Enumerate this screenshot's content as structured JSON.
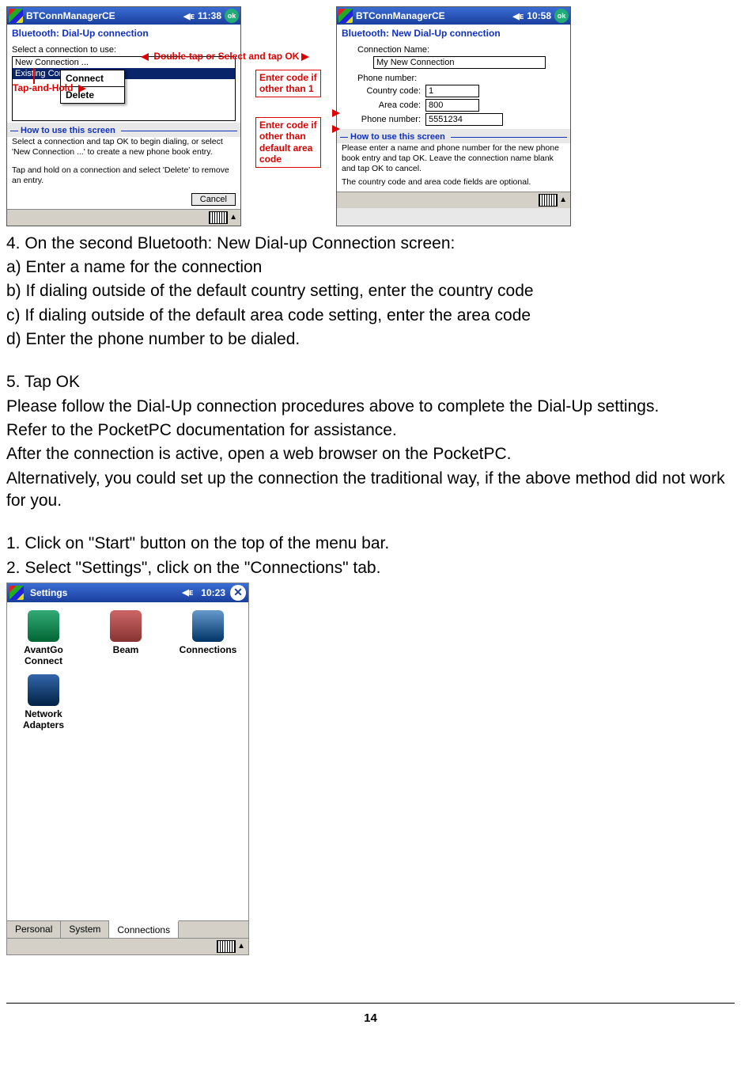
{
  "shot1": {
    "app_title": "BTConnManagerCE",
    "clock": "11:38",
    "ok": "ok",
    "subtitle": "Bluetooth: Dial-Up connection",
    "prompt": "Select a connection to use:",
    "list": {
      "item0": "New Connection ...",
      "item1_selected": "Existing Connection"
    },
    "ctx": {
      "connect": "Connect",
      "delete": "Delete"
    },
    "how_header": "How to use this screen",
    "help1": "Select a connection and tap OK to begin dialing, or select 'New Connection ...' to create a new phone book entry.",
    "help2": "Tap and hold on a connection and select 'Delete' to remove an entry.",
    "cancel": "Cancel"
  },
  "ann": {
    "doubletap": "Double-tap or Select and tap OK",
    "taphold": "Tap-and-Hold",
    "enter1a": "Enter code if",
    "enter1b": "other than 1",
    "enter2a": "Enter code if",
    "enter2b": "other than",
    "enter2c": "default area",
    "enter2d": "code"
  },
  "shot2": {
    "app_title": "BTConnManagerCE",
    "clock": "10:58",
    "ok": "ok",
    "subtitle": "Bluetooth: New Dial-Up connection",
    "name_label": "Connection Name:",
    "name_value": "My New Connection",
    "phone_label": "Phone number:",
    "cc_label": "Country code:",
    "cc_value": "1",
    "ac_label": "Area code:",
    "ac_value": "800",
    "pn_label": "Phone number:",
    "pn_value": "5551234",
    "how_header": "How to use this screen",
    "help1": "Please enter a name and phone number for the new phone book entry and tap OK. Leave the connection name blank and tap OK to cancel.",
    "help2": "The country code and area code fields are optional."
  },
  "body": {
    "l1": "4. On the second Bluetooth: New Dial-up Connection screen:",
    "l2": "a) Enter a name for the connection",
    "l3": "b) If dialing outside of the default country setting, enter the country code",
    "l4": "c) If dialing outside of the default area code setting, enter the area code",
    "l5": "d) Enter the phone number to be dialed.",
    "l6": "5. Tap OK",
    "l7": "Please follow the Dial-Up connection procedures above to complete the Dial-Up settings.",
    "l8": "Refer to the PocketPC documentation for assistance.",
    "l9": "After the connection is active, open a web browser on the PocketPC.",
    "l10": "Alternatively, you could set up the connection the traditional way, if the above method did not work for you.",
    "l11": "1. Click on \"Start\" button on the top of the menu bar.",
    "l12": "2. Select \"Settings\", click on the \"Connections\" tab."
  },
  "shot3": {
    "app_title": "Settings",
    "clock": "10:23",
    "close": "✕",
    "icons": {
      "avantgo": "AvantGo Connect",
      "beam": "Beam",
      "connections": "Connections",
      "network": "Network Adapters"
    },
    "tabs": {
      "personal": "Personal",
      "system": "System",
      "connections": "Connections"
    }
  },
  "page_number": "14"
}
